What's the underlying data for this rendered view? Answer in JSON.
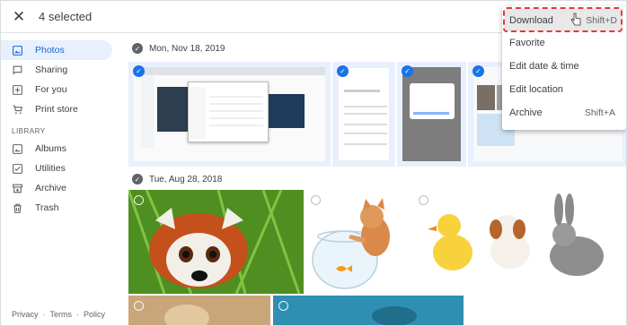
{
  "topbar": {
    "close_icon": "close-icon",
    "selected_text": "4 selected"
  },
  "sidebar": {
    "items": [
      {
        "label": "Photos",
        "icon": "photo-icon",
        "active": true
      },
      {
        "label": "Sharing",
        "icon": "chat-icon"
      },
      {
        "label": "For you",
        "icon": "plus-box-icon"
      },
      {
        "label": "Print store",
        "icon": "cart-icon"
      }
    ],
    "library_header": "LIBRARY",
    "library_items": [
      {
        "label": "Albums",
        "icon": "album-icon"
      },
      {
        "label": "Utilities",
        "icon": "utilities-icon"
      },
      {
        "label": "Archive",
        "icon": "archive-icon"
      },
      {
        "label": "Trash",
        "icon": "trash-icon"
      }
    ],
    "footer": {
      "privacy": "Privacy",
      "sep1": "·",
      "terms": "Terms",
      "sep2": "·",
      "policy": "Policy"
    }
  },
  "groups": [
    {
      "date": "Mon, Nov 18, 2019"
    },
    {
      "date": "Tue, Aug 28, 2018"
    }
  ],
  "menu": {
    "items": [
      {
        "label": "Download",
        "shortcut": "Shift+D",
        "highlighted": true
      },
      {
        "label": "Favorite",
        "shortcut": ""
      },
      {
        "label": "Edit date & time",
        "shortcut": ""
      },
      {
        "label": "Edit location",
        "shortcut": ""
      },
      {
        "label": "Archive",
        "shortcut": "Shift+A"
      }
    ]
  },
  "colors": {
    "accent": "#1a73e8",
    "selected_bg": "#e8f0fe",
    "highlight_border": "#e53935"
  }
}
